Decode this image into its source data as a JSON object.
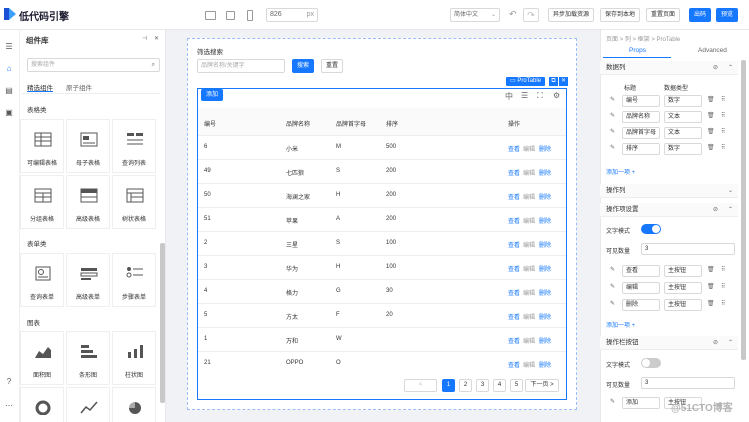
{
  "header": {
    "logo_text": "低代码引擎",
    "canvas_width": "826",
    "canvas_unit": "px",
    "locale": "简体中文",
    "buttons": [
      "异步加载资源",
      "保存到本地",
      "重置页面",
      "出码",
      "预览"
    ]
  },
  "library": {
    "title": "组件库",
    "search_placeholder": "搜索组件",
    "tabs": [
      "精选组件",
      "原子组件"
    ],
    "sections": [
      {
        "title": "表格类",
        "items": [
          "可编辑表格",
          "母子表格",
          "查询列表",
          "分组表格",
          "高级表格",
          "树状表格"
        ]
      },
      {
        "title": "表单类",
        "items": [
          "查询表单",
          "高级表单",
          "步骤表单"
        ]
      },
      {
        "title": "图表",
        "items": [
          "面积图",
          "条形图",
          "柱状图"
        ]
      }
    ]
  },
  "canvas": {
    "filter_label": "筛选搜索",
    "filter_placeholder": "品牌名称/关键字",
    "search_button": "搜索",
    "reset_button": "重置",
    "component_tag": "ProTable",
    "add_button": "添加",
    "columns": [
      "编号",
      "品牌名称",
      "品牌首字母",
      "排序",
      "操作"
    ],
    "actions": [
      "查看",
      "编辑",
      "删除"
    ],
    "rows": [
      [
        "6",
        "小米",
        "M",
        "500"
      ],
      [
        "49",
        "七匹狼",
        "S",
        "200"
      ],
      [
        "50",
        "海澜之家",
        "H",
        "200"
      ],
      [
        "51",
        "苹果",
        "A",
        "200"
      ],
      [
        "2",
        "三星",
        "S",
        "100"
      ],
      [
        "3",
        "华为",
        "H",
        "100"
      ],
      [
        "4",
        "格力",
        "G",
        "30"
      ],
      [
        "5",
        "方太",
        "F",
        "20"
      ],
      [
        "1",
        "万和",
        "W",
        ""
      ],
      [
        "21",
        "OPPO",
        "O",
        ""
      ]
    ],
    "pagination": {
      "prev": "<",
      "pages": [
        "1",
        "2",
        "3",
        "4",
        "5"
      ],
      "next": "下一页 >",
      "current": "1"
    }
  },
  "settings": {
    "breadcrumb": "页面 > 列 > 框架 > ProTable",
    "tabs": [
      "Props",
      "Advanced"
    ],
    "data_columns": {
      "title": "数据列",
      "col_title_label": "标题",
      "col_type_label": "数据类型",
      "rows": [
        {
          "title": "编号",
          "type": "数字"
        },
        {
          "title": "品牌名称",
          "type": "文本"
        },
        {
          "title": "品牌首字母",
          "type": "文本"
        },
        {
          "title": "排序",
          "type": "数字"
        }
      ],
      "add_link": "添加一项 +"
    },
    "action_column": {
      "title": "操作列"
    },
    "action_bar": {
      "title": "操作项设置",
      "text_mode_label": "文字模式",
      "visible_count_label": "可见数量",
      "visible_count": "3",
      "rows": [
        {
          "title": "查看",
          "type": "主按钮"
        },
        {
          "title": "编辑",
          "type": "主按钮"
        },
        {
          "title": "删除",
          "type": "主按钮"
        }
      ],
      "add_link": "添加一项 +"
    },
    "toolbar_section": {
      "title": "操作栏按钮",
      "text_mode_label": "文字模式",
      "visible_count_label": "可见数量",
      "visible_count": "3",
      "row": {
        "title": "添加",
        "type": "主按钮"
      }
    }
  },
  "watermark": "@51CTO博客"
}
